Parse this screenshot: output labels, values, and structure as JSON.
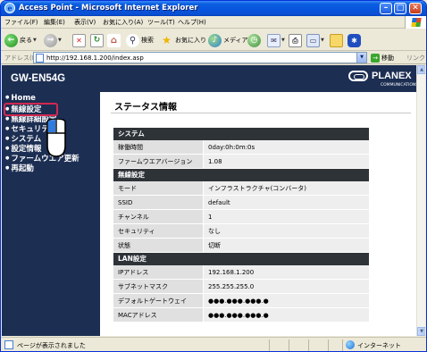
{
  "window": {
    "title": "Access Point - Microsoft Internet Explorer"
  },
  "menu": [
    "ファイル(F)",
    "編集(E)",
    "表示(V)",
    "お気に入り(A)",
    "ツール(T)",
    "ヘルプ(H)"
  ],
  "toolbar": {
    "back_label": "戻る",
    "search_label": "検索",
    "favorites_label": "お気に入り",
    "media_label": "メディア"
  },
  "address": {
    "label": "アドレス(D)",
    "url": "http://192.168.1.200/index.asp",
    "go_label": "移動",
    "links_label": "リンク"
  },
  "device": {
    "model": "GW-EN54G",
    "brand": "PLANEX",
    "brand_sub": "COMMUNICATIONS"
  },
  "sidebar": {
    "items": [
      {
        "label": "Home"
      },
      {
        "label": "無線設定"
      },
      {
        "label": "無線詳細設定"
      },
      {
        "label": "セキュリティ"
      },
      {
        "label": "システム"
      },
      {
        "label": "設定情報"
      },
      {
        "label": "ファームウエア更新"
      },
      {
        "label": "再起動"
      }
    ]
  },
  "main": {
    "heading": "ステータス情報",
    "sections": [
      {
        "title": "システム",
        "rows": [
          {
            "key": "稼働時間",
            "value": "0day:0h:0m:0s"
          },
          {
            "key": "ファームウエアバージョン",
            "value": "1.08"
          }
        ]
      },
      {
        "title": "無線設定",
        "rows": [
          {
            "key": "モード",
            "value": "インフラストラクチャ(コンバータ)"
          },
          {
            "key": "SSID",
            "value": "default"
          },
          {
            "key": "チャンネル",
            "value": "1"
          },
          {
            "key": "セキュリティ",
            "value": "なし"
          },
          {
            "key": "状態",
            "value": "切断"
          }
        ]
      },
      {
        "title": "LAN設定",
        "rows": [
          {
            "key": "IPアドレス",
            "value": "192.168.1.200"
          },
          {
            "key": "サブネットマスク",
            "value": "255.255.255.0"
          },
          {
            "key": "デフォルトゲートウェイ",
            "value": "●●●.●●●.●●●.●"
          },
          {
            "key": "MACアドレス",
            "value": "●●●.●●●.●●●.●"
          }
        ]
      }
    ]
  },
  "status": {
    "text": "ページが表示されました",
    "zone": "インターネット"
  }
}
